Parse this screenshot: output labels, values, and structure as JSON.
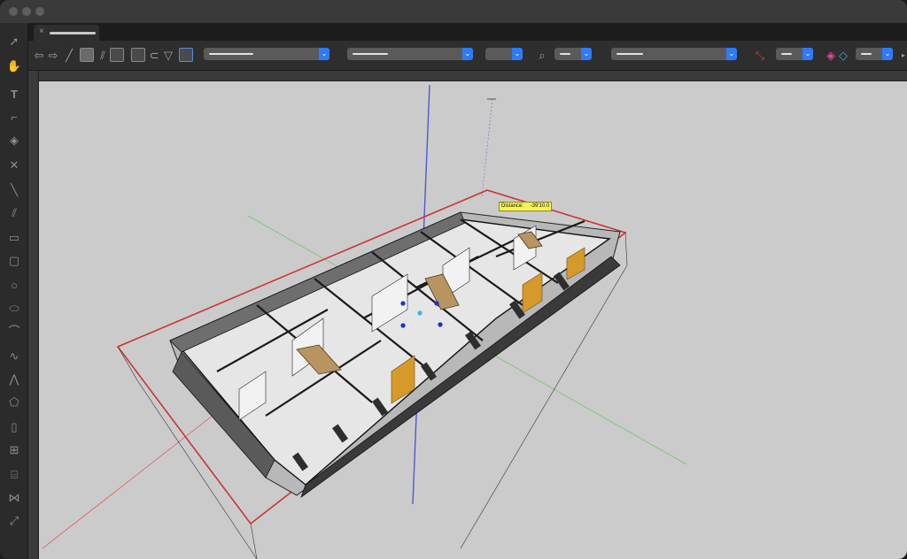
{
  "window": {
    "traffic_lights": [
      "close",
      "minimize",
      "zoom"
    ]
  },
  "tab": {
    "close_glyph": "×"
  },
  "toolbar": {
    "icons": [
      "arrow-left-icon",
      "arrow-right-icon",
      "pen-icon",
      "line-tool-icon",
      "double-line-icon",
      "mountain-icon",
      "rect-fill-icon",
      "lasso-icon",
      "polygon-select-icon",
      "grid-select-icon",
      "search-icon",
      "axis-icon",
      "layers-icon"
    ],
    "accent_color": "#2f7bf5"
  },
  "sidebar": {
    "tools": [
      "selection-arrow-icon",
      "pan-hand-icon",
      "text-tool-icon",
      "callout-icon",
      "fill-bucket-icon",
      "x-icon",
      "line-icon",
      "double-line-icon",
      "rectangle-icon",
      "rounded-rectangle-icon",
      "circle-icon",
      "oval-icon",
      "arc-icon",
      "freehand-icon",
      "polyline-icon",
      "polygon-icon",
      "door-icon",
      "window-icon",
      "stair-icon",
      "wall-tool-icon",
      "dimension-icon"
    ]
  },
  "canvas": {
    "background": "#cbcbcb",
    "tooltip": {
      "label": "Distance:",
      "value": "-39'10.0"
    }
  }
}
